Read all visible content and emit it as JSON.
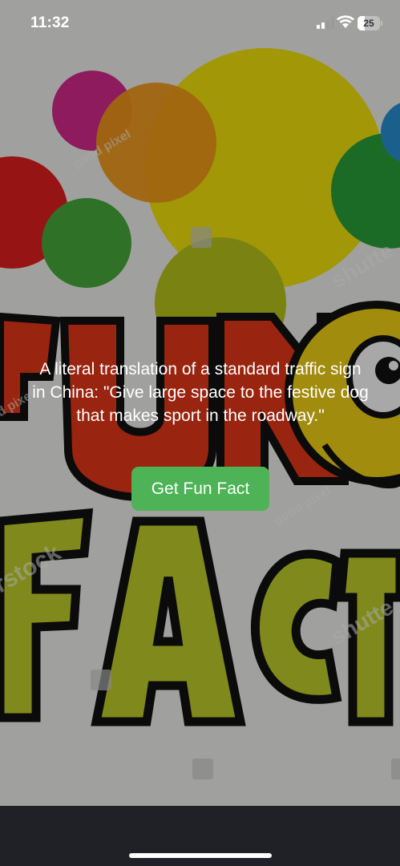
{
  "status_bar": {
    "time": "11:32",
    "battery_level": "25"
  },
  "background": {
    "description_icon": "fun-facts-logo-image",
    "watermarks": [
      "shutterstock",
      "good pixel"
    ]
  },
  "fact": {
    "text": "A literal translation of a standard traffic sign in China: \"Give large space to the festive dog that makes sport in the roadway.\""
  },
  "action": {
    "button_label": "Get Fun Fact",
    "button_color": "#4db356"
  }
}
